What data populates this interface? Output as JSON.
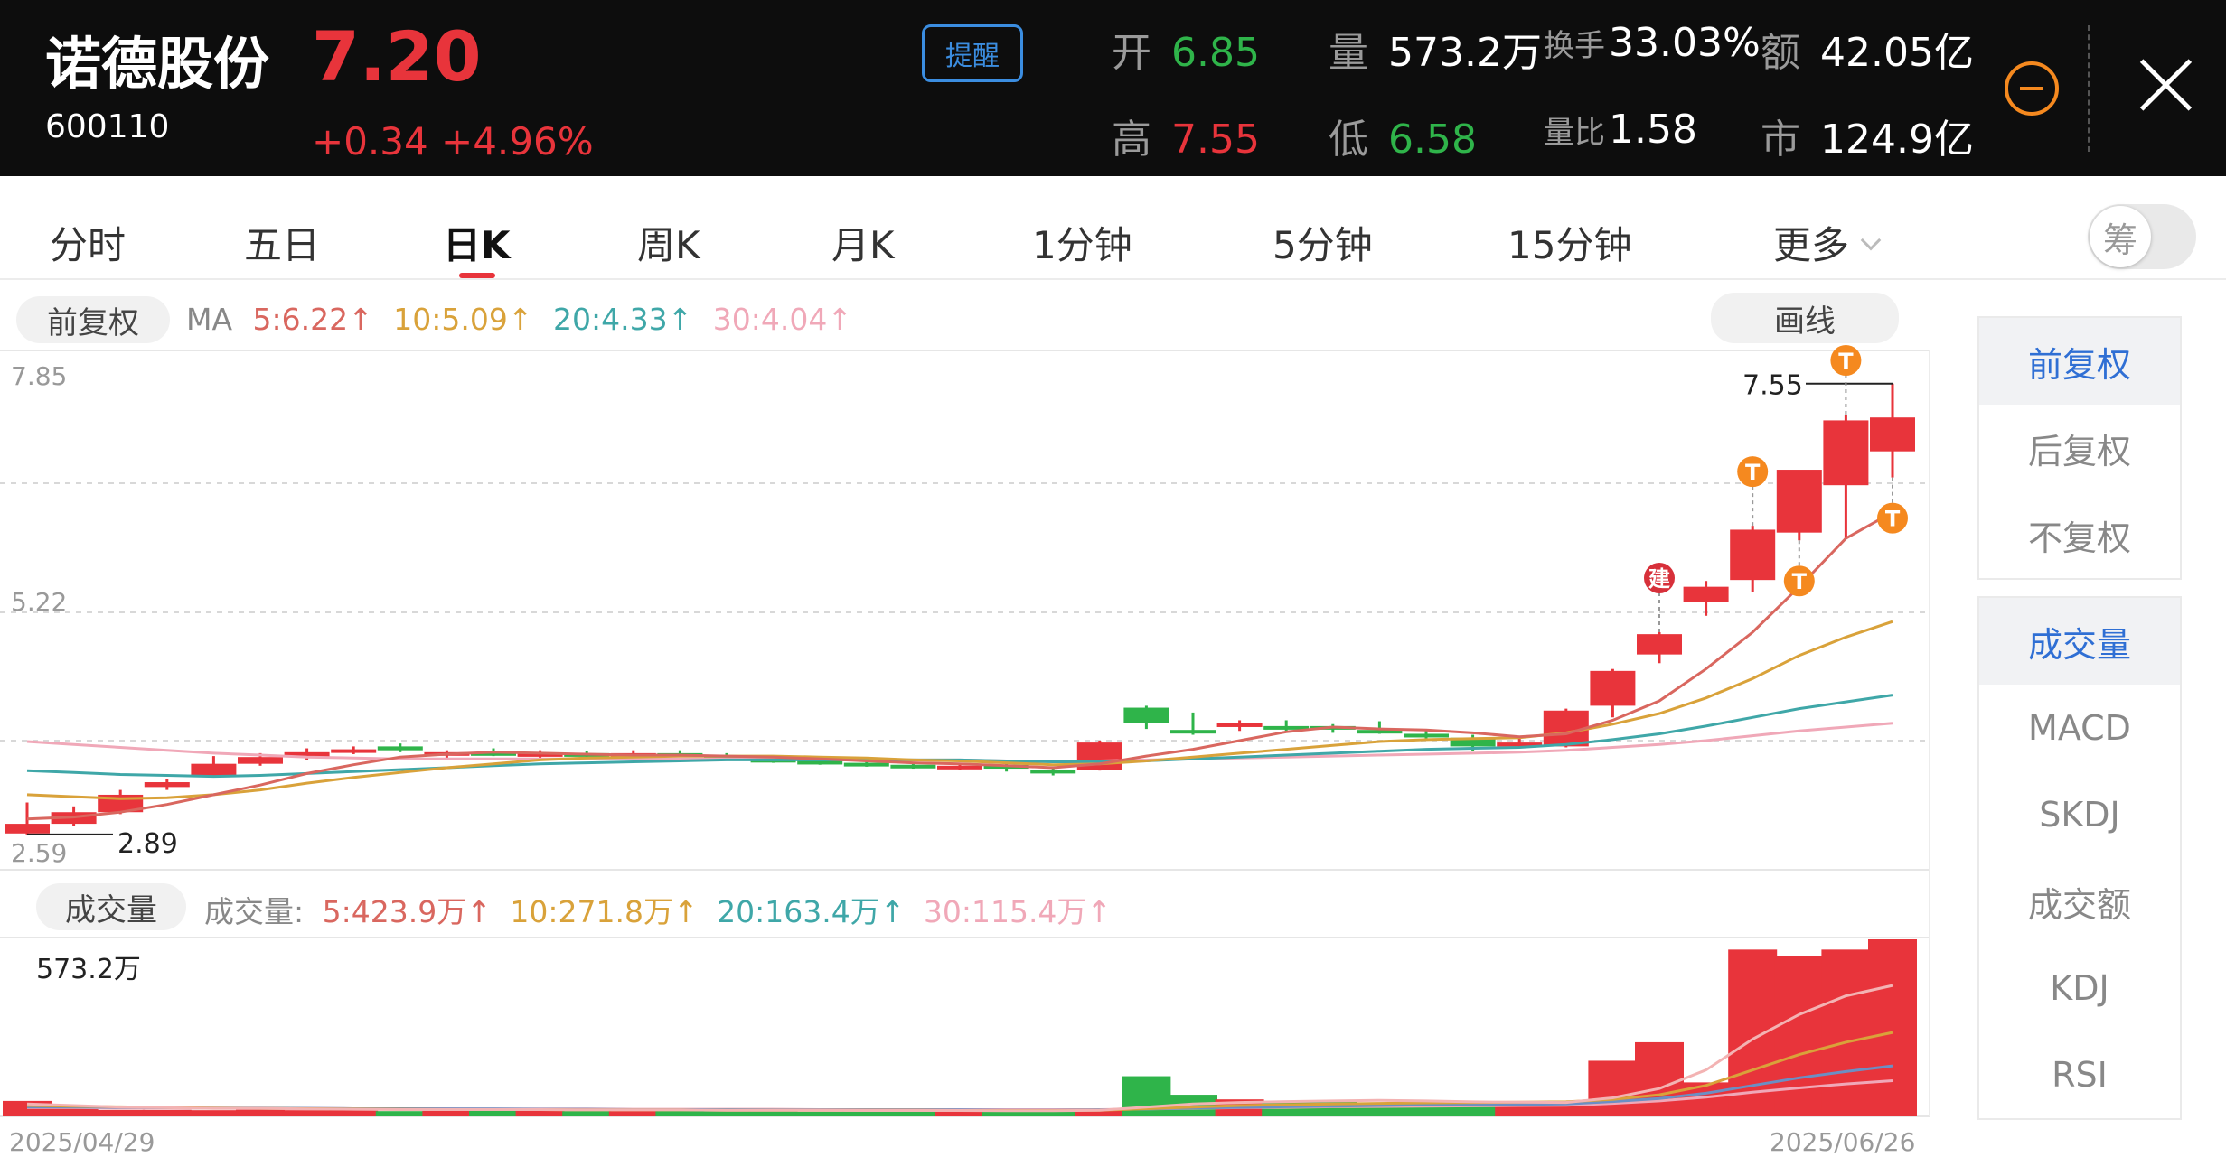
{
  "header": {
    "name": "诺德股份",
    "code": "600110",
    "price": "7.20",
    "change": "+0.34",
    "change_pct": "+4.96%",
    "remind_label": "提醒",
    "open_label": "开",
    "open_value": "6.85",
    "high_label": "高",
    "high_value": "7.55",
    "volume_label": "量",
    "volume_value": "573.2万",
    "low_label": "低",
    "low_value": "6.58",
    "turnover_label": "换手",
    "turnover_value": "33.03%",
    "volratio_label": "量比",
    "volratio_value": "1.58",
    "amount_label": "额",
    "amount_value": "42.05亿",
    "mcap_label": "市",
    "mcap_value": "124.9亿"
  },
  "tabs": {
    "items": [
      "分时",
      "五日",
      "日K",
      "周K",
      "月K",
      "1分钟",
      "5分钟",
      "15分钟",
      "更多"
    ],
    "active": "日K",
    "chip_label": "筹"
  },
  "kline": {
    "adjust_label": "前复权",
    "draw_label": "画线",
    "ma_label": "MA",
    "ma5": "5:6.22↑",
    "ma10": "10:5.09↑",
    "ma20": "20:4.33↑",
    "ma30": "30:4.04↑",
    "axis_high": "7.85",
    "axis_mid": "5.22",
    "axis_low": "2.59",
    "max_label": "7.55",
    "min_label": "2.89",
    "build_marker": "建",
    "t_marker": "T"
  },
  "volume": {
    "label": "成交量",
    "prefix": "成交量:",
    "ma5": "5:423.9万↑",
    "ma10": "10:271.8万↑",
    "ma20": "20:163.4万↑",
    "ma30": "30:115.4万↑",
    "max_label": "573.2万",
    "start_date": "2025/04/29",
    "end_date": "2025/06/26"
  },
  "right_panel": {
    "adjust_items": [
      "前复权",
      "后复权",
      "不复权"
    ],
    "indicator_items": [
      "成交量",
      "MACD",
      "SKDJ",
      "成交额",
      "KDJ",
      "RSI"
    ],
    "active_adjust": "前复权",
    "active_indicator": "成交量"
  },
  "colors": {
    "up": "#e8343b",
    "down": "#2fb44a",
    "accent_blue": "#2f6fd4",
    "ma5": "#d9675f",
    "ma10": "#d9a23a",
    "ma20": "#3fa7a8",
    "ma30": "#f0a8b8",
    "marker_orange": "#f5891f"
  },
  "chart_data": {
    "type": "candlestick",
    "y_range": [
      2.59,
      7.85
    ],
    "candles": [
      {
        "o": 2.9,
        "h": 3.22,
        "l": 2.89,
        "c": 3.0
      },
      {
        "o": 3.0,
        "h": 3.18,
        "l": 2.98,
        "c": 3.12
      },
      {
        "o": 3.12,
        "h": 3.35,
        "l": 3.1,
        "c": 3.3
      },
      {
        "o": 3.38,
        "h": 3.46,
        "l": 3.35,
        "c": 3.43
      },
      {
        "o": 3.5,
        "h": 3.7,
        "l": 3.48,
        "c": 3.62
      },
      {
        "o": 3.62,
        "h": 3.73,
        "l": 3.6,
        "c": 3.69
      },
      {
        "o": 3.69,
        "h": 3.78,
        "l": 3.66,
        "c": 3.74
      },
      {
        "o": 3.76,
        "h": 3.8,
        "l": 3.72,
        "c": 3.77
      },
      {
        "o": 3.8,
        "h": 3.83,
        "l": 3.74,
        "c": 3.76
      },
      {
        "o": 3.72,
        "h": 3.76,
        "l": 3.68,
        "c": 3.74
      },
      {
        "o": 3.74,
        "h": 3.78,
        "l": 3.7,
        "c": 3.71
      },
      {
        "o": 3.7,
        "h": 3.76,
        "l": 3.66,
        "c": 3.73
      },
      {
        "o": 3.73,
        "h": 3.75,
        "l": 3.69,
        "c": 3.71
      },
      {
        "o": 3.73,
        "h": 3.76,
        "l": 3.7,
        "c": 3.73
      },
      {
        "o": 3.73,
        "h": 3.76,
        "l": 3.69,
        "c": 3.7
      },
      {
        "o": 3.7,
        "h": 3.73,
        "l": 3.66,
        "c": 3.67
      },
      {
        "o": 3.67,
        "h": 3.7,
        "l": 3.63,
        "c": 3.65
      },
      {
        "o": 3.65,
        "h": 3.68,
        "l": 3.61,
        "c": 3.63
      },
      {
        "o": 3.63,
        "h": 3.66,
        "l": 3.59,
        "c": 3.61
      },
      {
        "o": 3.61,
        "h": 3.64,
        "l": 3.57,
        "c": 3.59
      },
      {
        "o": 3.59,
        "h": 3.62,
        "l": 3.56,
        "c": 3.6
      },
      {
        "o": 3.61,
        "h": 3.65,
        "l": 3.54,
        "c": 3.57
      },
      {
        "o": 3.56,
        "h": 3.59,
        "l": 3.5,
        "c": 3.52
      },
      {
        "o": 3.56,
        "h": 3.86,
        "l": 3.55,
        "c": 3.84
      },
      {
        "o": 4.2,
        "h": 4.22,
        "l": 3.98,
        "c": 4.04
      },
      {
        "o": 3.97,
        "h": 4.15,
        "l": 3.92,
        "c": 3.94
      },
      {
        "o": 4.0,
        "h": 4.07,
        "l": 3.96,
        "c": 4.04
      },
      {
        "o": 4.01,
        "h": 4.07,
        "l": 3.96,
        "c": 3.99
      },
      {
        "o": 4.01,
        "h": 4.03,
        "l": 3.94,
        "c": 4.0
      },
      {
        "o": 3.97,
        "h": 4.06,
        "l": 3.93,
        "c": 3.95
      },
      {
        "o": 3.93,
        "h": 3.97,
        "l": 3.88,
        "c": 3.9
      },
      {
        "o": 3.89,
        "h": 3.92,
        "l": 3.75,
        "c": 3.8
      },
      {
        "o": 3.8,
        "h": 3.9,
        "l": 3.78,
        "c": 3.84
      },
      {
        "o": 3.8,
        "h": 4.19,
        "l": 3.79,
        "c": 4.17
      },
      {
        "o": 4.22,
        "h": 4.6,
        "l": 4.1,
        "c": 4.58
      },
      {
        "o": 4.75,
        "h": 4.98,
        "l": 4.66,
        "c": 4.96
      },
      {
        "o": 5.29,
        "h": 5.51,
        "l": 5.15,
        "c": 5.45
      },
      {
        "o": 5.52,
        "h": 6.08,
        "l": 5.4,
        "c": 6.04
      },
      {
        "o": 6.01,
        "h": 6.62,
        "l": 5.93,
        "c": 6.66
      },
      {
        "o": 6.5,
        "h": 7.23,
        "l": 5.95,
        "c": 7.17
      },
      {
        "o": 6.85,
        "h": 7.55,
        "l": 6.58,
        "c": 7.2
      }
    ],
    "ma5": [
      3.05,
      3.07,
      3.12,
      3.2,
      3.3,
      3.4,
      3.52,
      3.61,
      3.69,
      3.72,
      3.74,
      3.73,
      3.72,
      3.71,
      3.71,
      3.7,
      3.69,
      3.67,
      3.65,
      3.63,
      3.62,
      3.6,
      3.58,
      3.62,
      3.7,
      3.77,
      3.86,
      3.95,
      4.0,
      3.98,
      3.97,
      3.94,
      3.9,
      3.93,
      4.07,
      4.27,
      4.6,
      4.98,
      5.45,
      5.95,
      6.22
    ],
    "ma10": [
      3.3,
      3.28,
      3.26,
      3.27,
      3.3,
      3.35,
      3.42,
      3.48,
      3.53,
      3.58,
      3.62,
      3.66,
      3.68,
      3.69,
      3.7,
      3.7,
      3.7,
      3.69,
      3.68,
      3.66,
      3.65,
      3.63,
      3.61,
      3.62,
      3.65,
      3.69,
      3.73,
      3.77,
      3.81,
      3.85,
      3.87,
      3.88,
      3.89,
      3.94,
      4.03,
      4.14,
      4.3,
      4.5,
      4.74,
      4.93,
      5.09
    ],
    "ma20": [
      3.55,
      3.53,
      3.51,
      3.5,
      3.49,
      3.5,
      3.52,
      3.54,
      3.56,
      3.58,
      3.6,
      3.62,
      3.63,
      3.64,
      3.65,
      3.66,
      3.66,
      3.66,
      3.66,
      3.66,
      3.66,
      3.65,
      3.64,
      3.64,
      3.65,
      3.67,
      3.69,
      3.71,
      3.73,
      3.75,
      3.77,
      3.78,
      3.79,
      3.82,
      3.87,
      3.93,
      4.01,
      4.1,
      4.19,
      4.26,
      4.33
    ],
    "ma30": [
      3.85,
      3.82,
      3.79,
      3.76,
      3.73,
      3.71,
      3.69,
      3.68,
      3.67,
      3.67,
      3.67,
      3.67,
      3.67,
      3.67,
      3.67,
      3.67,
      3.67,
      3.67,
      3.66,
      3.66,
      3.66,
      3.65,
      3.65,
      3.65,
      3.66,
      3.67,
      3.68,
      3.69,
      3.7,
      3.71,
      3.72,
      3.73,
      3.74,
      3.76,
      3.79,
      3.82,
      3.86,
      3.91,
      3.96,
      4.0,
      4.04
    ],
    "volume": [
      50,
      26,
      21,
      21,
      20,
      29,
      20,
      20,
      17,
      19,
      18,
      18,
      17,
      17,
      17,
      16,
      16,
      15,
      15,
      16,
      16,
      15,
      17,
      25,
      130,
      70,
      55,
      50,
      48,
      45,
      45,
      44,
      42,
      40,
      180,
      240,
      110,
      540,
      520,
      540,
      573.2
    ],
    "volume_ma5": [
      40,
      35,
      30,
      28,
      26,
      26,
      24,
      23,
      22,
      22,
      22,
      22,
      21,
      21,
      21,
      20,
      20,
      20,
      19,
      19,
      19,
      18,
      18,
      20,
      30,
      40,
      45,
      48,
      50,
      52,
      50,
      47,
      46,
      45,
      60,
      90,
      150,
      250,
      330,
      390,
      423.9
    ],
    "volume_ma10": [
      35,
      33,
      31,
      29,
      27,
      26,
      25,
      24,
      23,
      22,
      22,
      22,
      21,
      21,
      21,
      20,
      20,
      20,
      20,
      20,
      19,
      19,
      19,
      20,
      25,
      30,
      35,
      38,
      40,
      42,
      44,
      45,
      46,
      47,
      55,
      70,
      100,
      150,
      200,
      240,
      271.8
    ],
    "volume_ma20": [
      30,
      30,
      29,
      28,
      27,
      27,
      26,
      25,
      25,
      24,
      24,
      23,
      23,
      22,
      22,
      22,
      21,
      21,
      21,
      21,
      21,
      20,
      20,
      21,
      24,
      27,
      29,
      31,
      33,
      35,
      37,
      38,
      39,
      40,
      48,
      58,
      75,
      100,
      125,
      145,
      163.4
    ],
    "volume_ma30": [
      28,
      28,
      27,
      27,
      26,
      26,
      26,
      25,
      25,
      25,
      24,
      24,
      24,
      23,
      23,
      23,
      23,
      22,
      22,
      22,
      22,
      22,
      22,
      22,
      24,
      26,
      28,
      29,
      31,
      32,
      33,
      34,
      35,
      36,
      42,
      50,
      62,
      78,
      92,
      105,
      115.4
    ],
    "volume_max": 573.2,
    "build_marker_index": 35,
    "t_markers": [
      {
        "i": 37,
        "pos": "above"
      },
      {
        "i": 39,
        "pos": "above"
      },
      {
        "i": 38,
        "pos": "below"
      },
      {
        "i": 40,
        "pos": "below"
      }
    ]
  }
}
